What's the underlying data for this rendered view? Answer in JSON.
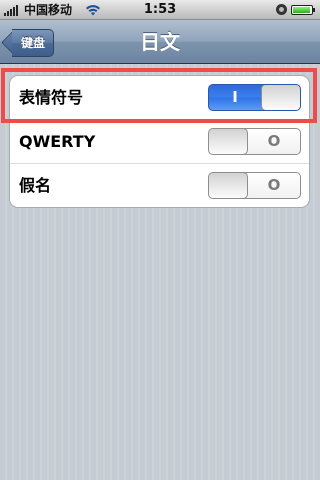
{
  "status_bar": {
    "carrier": "中国移动",
    "time": "1:53",
    "icons": [
      "signal-icon",
      "wifi-icon",
      "rotation-lock-icon",
      "battery-icon"
    ]
  },
  "nav": {
    "back_label": "键盘",
    "title": "日文"
  },
  "rows": [
    {
      "label": "表情符号",
      "switch_text": "I",
      "on": true
    },
    {
      "label": "QWERTY",
      "switch_text": "O",
      "on": false
    },
    {
      "label": "假名",
      "switch_text": "O",
      "on": false
    }
  ],
  "colors": {
    "nav_bar": "#6d84a2",
    "switch_on": "#3c7ff0",
    "highlight": "#ee4b4b",
    "background": "#c5ccd4"
  }
}
